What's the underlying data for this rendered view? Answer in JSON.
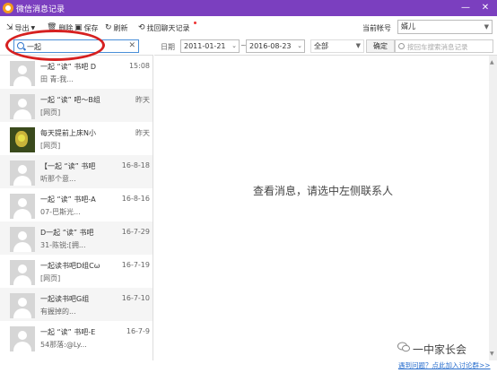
{
  "window": {
    "title": "微信消息记录",
    "minimize": "—",
    "close": "✕"
  },
  "toolbar": {
    "export": "导出",
    "delete": "删除",
    "save": "保存",
    "refresh": "刷新",
    "recover": "找回聊天记录",
    "account_label": "当前帐号",
    "account_value": "婿儿"
  },
  "search": {
    "value": "一起",
    "clear": "✕"
  },
  "filter": {
    "date_label": "日期",
    "start_date": "2011-01-21",
    "end_date": "2016-08-23",
    "tilde": "~",
    "scope": "全部",
    "ok": "确定",
    "placeholder": "按回车搜索消息记录"
  },
  "contacts": [
    {
      "name": "一起 “读” 书吧 D",
      "preview": "田 青:我...",
      "time": "15:08"
    },
    {
      "name": "一起 “读” 吧～B组",
      "preview": "[网页]",
      "time": "昨天"
    },
    {
      "name": "每天提前上床N小",
      "preview": "[网页]",
      "time": "昨天"
    },
    {
      "name": "【一起 “读” 书吧",
      "preview": "听那个意...",
      "time": "16-8-18"
    },
    {
      "name": "一起 “读” 书吧-A",
      "preview": "07-巴斯光...",
      "time": "16-8-16"
    },
    {
      "name": "D一起 “读” 书吧",
      "preview": "31-陈锐:[拥...",
      "time": "16-7-29"
    },
    {
      "name": "一起读书吧D组Cω",
      "preview": "[网页]",
      "time": "16-7-19"
    },
    {
      "name": "一起读书吧G组",
      "preview": "有握掉的...",
      "time": "16-7-10"
    },
    {
      "name": "一起 “读” 书吧-E",
      "preview": "54那落:@Ly...",
      "time": "16-7-9"
    }
  ],
  "viewer": {
    "hint": "查看消息，请选中左侧联系人"
  },
  "footer": {
    "watermark": "一中家长会",
    "help": "遇到问题？点此加入讨论群>>"
  },
  "colors": {
    "titlebar": "#7b3fbf",
    "link": "#2a6fce",
    "annotation": "#d62020"
  }
}
